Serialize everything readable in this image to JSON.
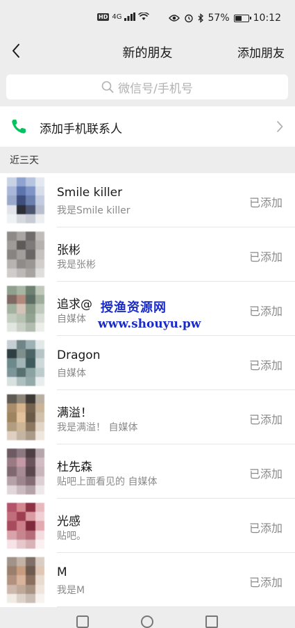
{
  "status_bar": {
    "hd": "HD",
    "signal": "4G",
    "battery_percent": "57%",
    "battery_level": 0.57,
    "time": "10:12"
  },
  "nav": {
    "title": "新的朋友",
    "action": "添加朋友"
  },
  "search": {
    "placeholder": "微信号/手机号"
  },
  "phone_contacts": {
    "label": "添加手机联系人"
  },
  "section": {
    "label": "近三天"
  },
  "friends": [
    {
      "name": "Smile killer",
      "message": "我是Smile killer",
      "status": "已添加"
    },
    {
      "name": "张彬",
      "message": "我是张彬",
      "status": "已添加"
    },
    {
      "name": "追求@",
      "message": "自媒体",
      "status": "已添加"
    },
    {
      "name": "Dragon",
      "message": "自媒体",
      "status": "已添加"
    },
    {
      "name": "满溢！",
      "message": "我是满溢！ 自媒体",
      "status": "已添加"
    },
    {
      "name": "杜先森",
      "message": "贴吧上面看见的 自媒体",
      "status": "已添加"
    },
    {
      "name": "光感",
      "message": "贴吧。",
      "status": "已添加"
    },
    {
      "name": "M",
      "message": "我是M",
      "status": "已添加"
    }
  ],
  "watermark": {
    "line1": "授渔资源网",
    "line2": "www.shouyu.pw"
  },
  "colors": {
    "accent_green": "#07c160",
    "watermark_blue": "#1a2bc6"
  },
  "avatars": [
    [
      "#c9d3e6",
      "#8ea3cf",
      "#b7c4df",
      "#e4e8f1",
      "#a9b8d8",
      "#5d74ad",
      "#7f95c7",
      "#d8dee9",
      "#9aa9c9",
      "#3e4f7d",
      "#6b7fae",
      "#c3cbe0",
      "#e1e4ea",
      "#2d2f38",
      "#4b5570",
      "#b9bfcd",
      "#f0f1f4",
      "#d5d8df",
      "#c7cbd4",
      "#eceef2"
    ],
    [
      "#8d8a88",
      "#a8a5a3",
      "#6f6c6b",
      "#bfbcba",
      "#9e9b99",
      "#5e5a59",
      "#7e7a78",
      "#b3b0ae",
      "#888482",
      "#a29e9c",
      "#6a6665",
      "#c4c1bf",
      "#b6b3b1",
      "#8f8b89",
      "#9a9694",
      "#d0cdcb",
      "#cfcccb",
      "#bcb9b7",
      "#a6a3a1",
      "#e0dedd"
    ],
    [
      "#8fa08f",
      "#a8b5a2",
      "#6e8173",
      "#c0c8bb",
      "#7f6a63",
      "#b08a7d",
      "#5c6d63",
      "#9fae9c",
      "#a3b1a1",
      "#d3c4b7",
      "#8b9b89",
      "#bfc9bc",
      "#c4cdc0",
      "#b6c1b2",
      "#93a392",
      "#d8ded6",
      "#e2e6e0",
      "#c9d0c6",
      "#b2bcaf",
      "#eceeea"
    ],
    [
      "#c6cfd2",
      "#6f8588",
      "#9db0b3",
      "#e3e8e9",
      "#2f3f42",
      "#7e8f8c",
      "#4d6466",
      "#b5c4c6",
      "#6d8a8b",
      "#a2b6b7",
      "#3e5a5c",
      "#cfd8d9",
      "#7c9598",
      "#58706f",
      "#8aa3a2",
      "#bccbcb",
      "#d8e0e0",
      "#aebfbf",
      "#94aaaa",
      "#e8eded"
    ],
    [
      "#5f5a52",
      "#8d8478",
      "#3d3a36",
      "#b8aea1",
      "#a88c6c",
      "#d6b58e",
      "#74624e",
      "#c9b49a",
      "#9f8460",
      "#e2c29c",
      "#6b5a48",
      "#d1c0ab",
      "#b39d80",
      "#cdb596",
      "#8c7760",
      "#e3d6c6",
      "#ddd0c0",
      "#c4b5a3",
      "#aa9a88",
      "#efe7de"
    ],
    [
      "#6e5b62",
      "#8c7880",
      "#4e3f45",
      "#b6a5ab",
      "#9a7a84",
      "#c49aa6",
      "#6a535b",
      "#d0bcc2",
      "#7f6870",
      "#a78c95",
      "#5a464d",
      "#c8b4bb",
      "#b7a1a8",
      "#9d868d",
      "#836c74",
      "#ddd0d4",
      "#e1d6d9",
      "#c9bbc0",
      "#b3a2a8",
      "#efe8ea"
    ],
    [
      "#b4546a",
      "#d4878f",
      "#8e3346",
      "#e7b9bf",
      "#c26d7a",
      "#9e3e51",
      "#d99aa2",
      "#f0d0d4",
      "#a84b5c",
      "#cd7f8a",
      "#7f2a3b",
      "#e2a9b1",
      "#d8a3ab",
      "#c6858f",
      "#b56e79",
      "#f3dde0",
      "#f5e3e6",
      "#e6c7cc",
      "#d9b2b8",
      "#fbf1f2"
    ],
    [
      "#a2938a",
      "#c4b2a6",
      "#7f6f66",
      "#d9cdc4",
      "#9b7f6d",
      "#c79c7f",
      "#6d5b50",
      "#e0c7b5",
      "#b39181",
      "#d9b49c",
      "#8a6e5e",
      "#eadbcf",
      "#cdb9ab",
      "#bfa898",
      "#a89282",
      "#efe5dd",
      "#f1ebe6",
      "#ddd2ca",
      "#c9bdb4",
      "#f7f3f0"
    ]
  ]
}
